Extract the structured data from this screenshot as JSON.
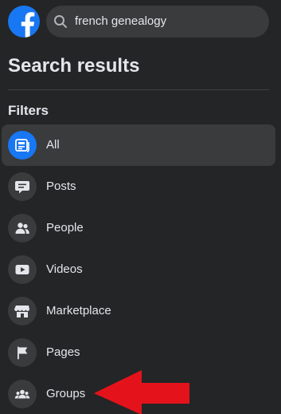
{
  "search": {
    "query": "french genealogy"
  },
  "page_title": "Search results",
  "filters_heading": "Filters",
  "filters": [
    {
      "label": "All",
      "icon": "news-feed-icon",
      "active": true
    },
    {
      "label": "Posts",
      "icon": "speech-bubble-icon",
      "active": false
    },
    {
      "label": "People",
      "icon": "people-icon",
      "active": false
    },
    {
      "label": "Videos",
      "icon": "video-play-icon",
      "active": false
    },
    {
      "label": "Marketplace",
      "icon": "storefront-icon",
      "active": false
    },
    {
      "label": "Pages",
      "icon": "flag-icon",
      "active": false
    },
    {
      "label": "Groups",
      "icon": "groups-icon",
      "active": false
    }
  ],
  "colors": {
    "background": "#242526",
    "facebook_blue": "#1877f2",
    "item_bg": "#3a3b3c",
    "arrow": "#e4131b"
  }
}
